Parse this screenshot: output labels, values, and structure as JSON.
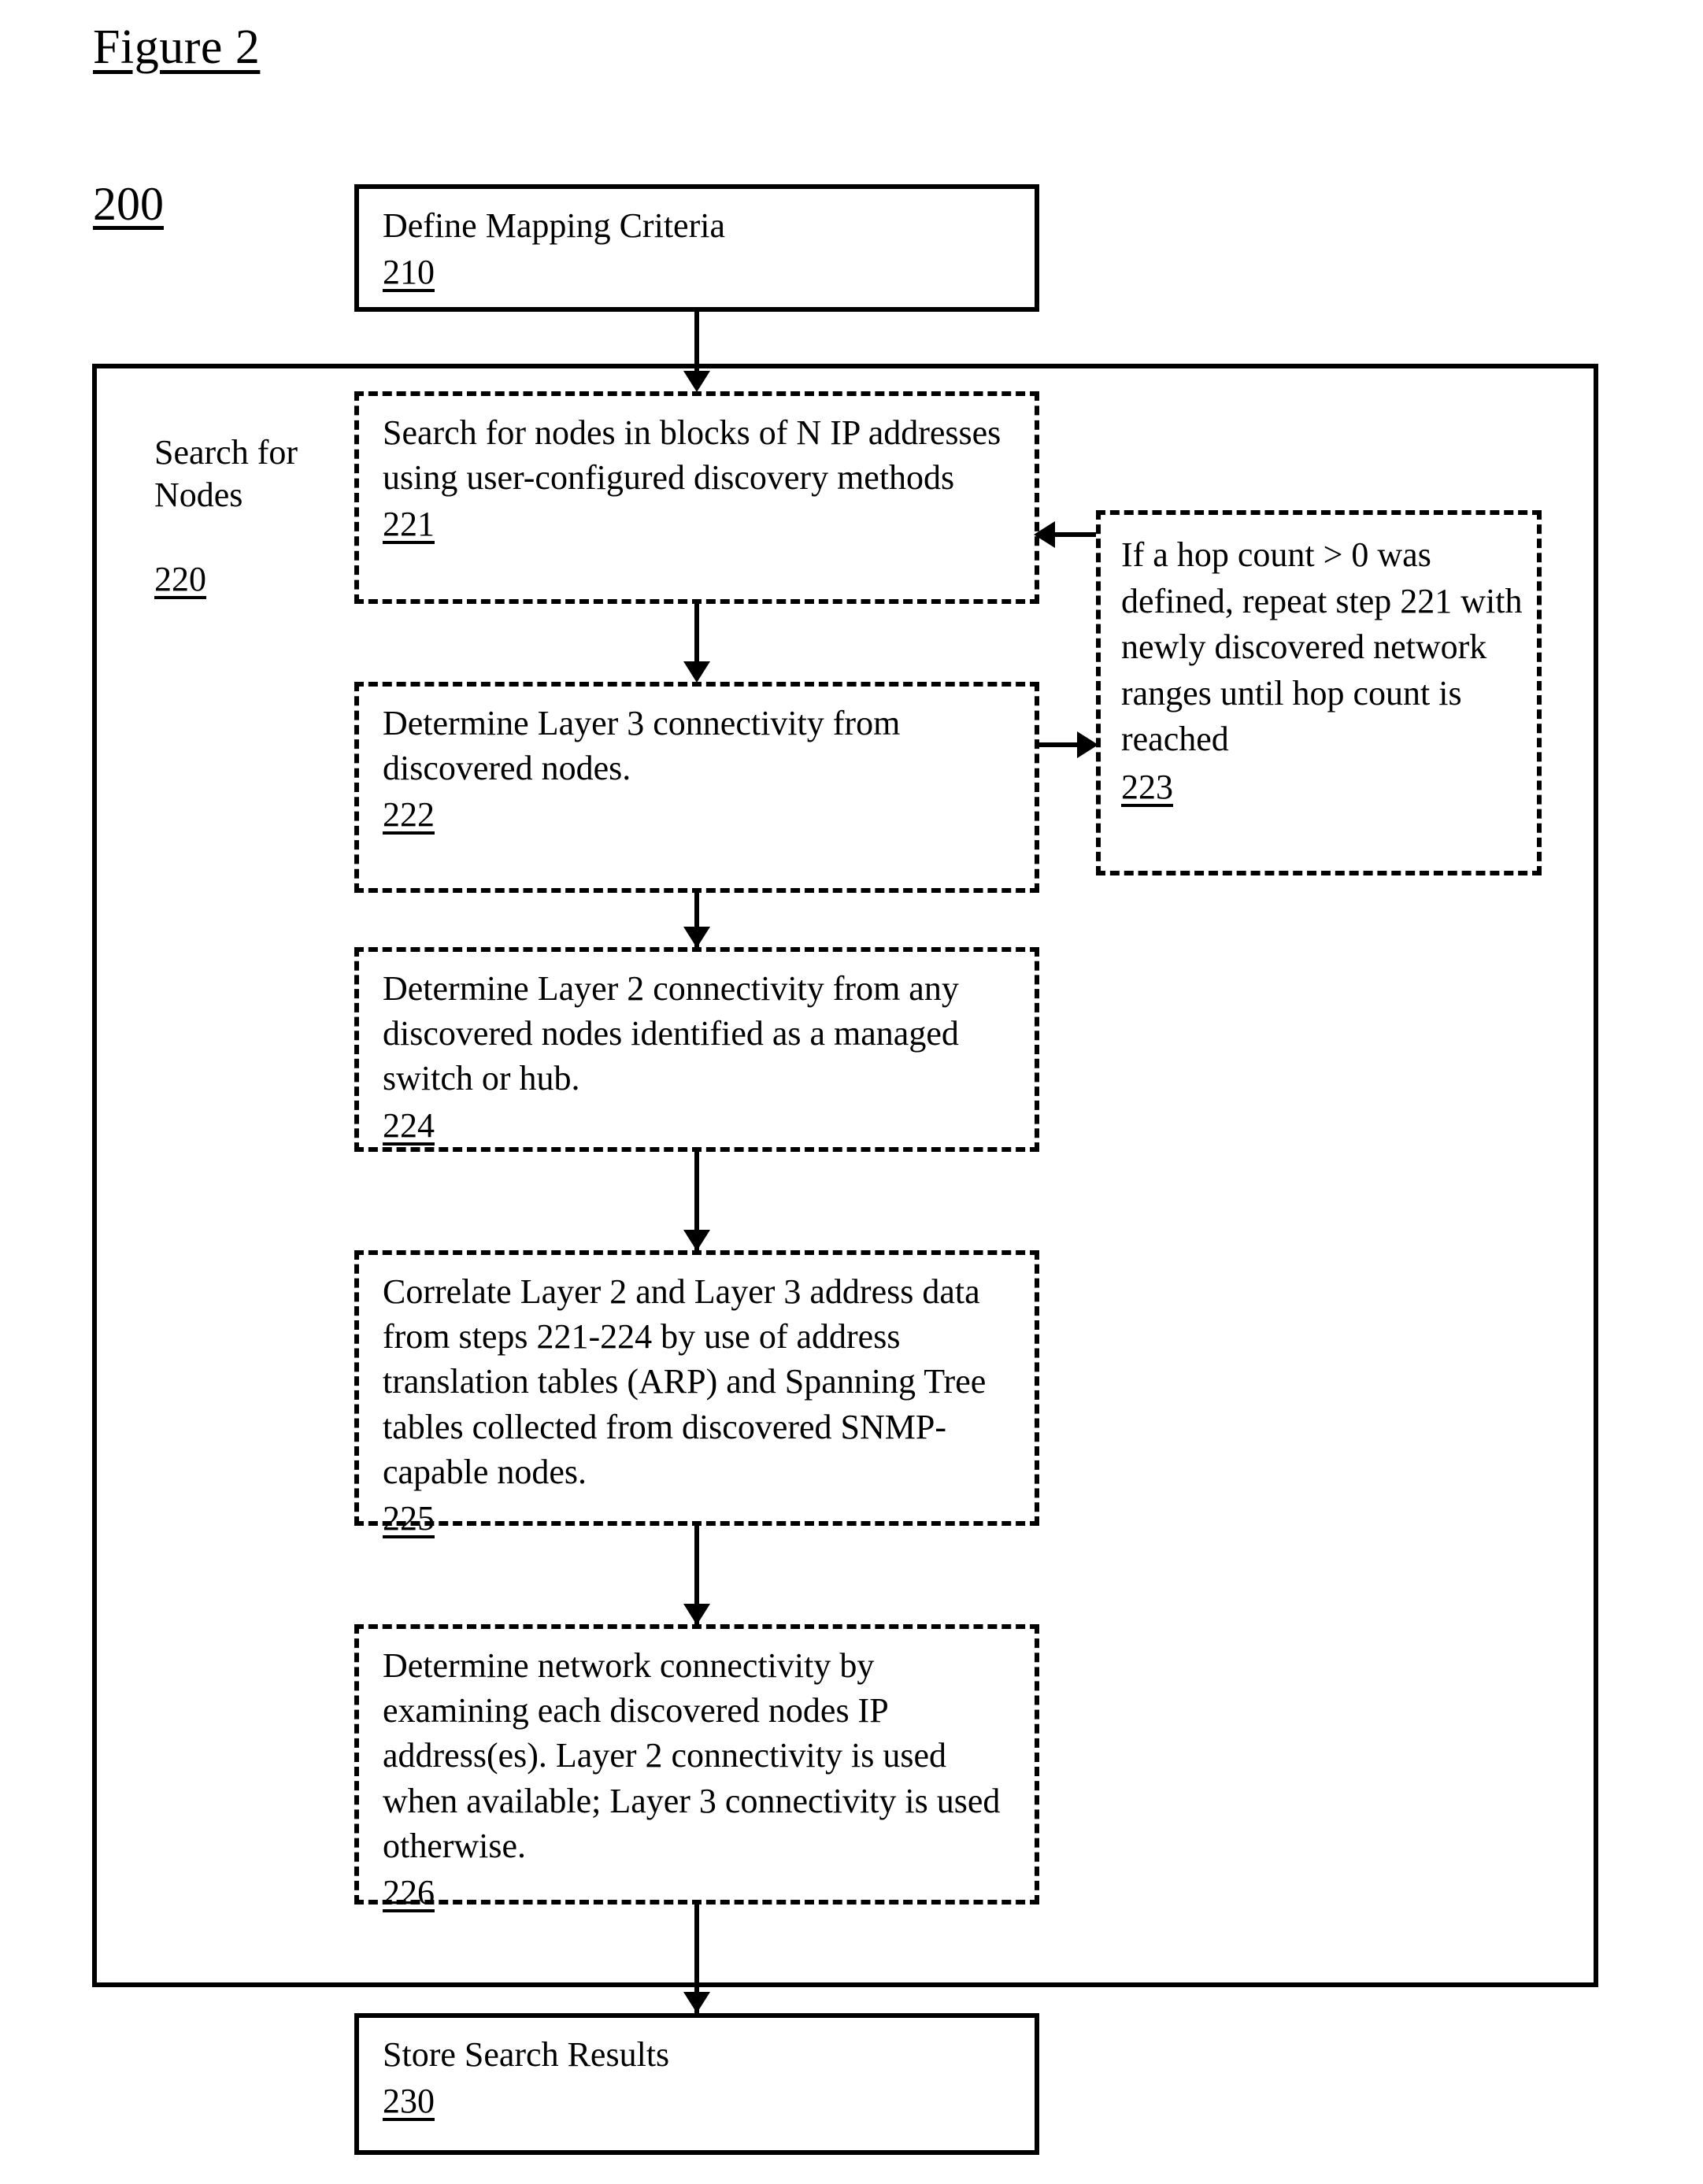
{
  "figure": {
    "title": "Figure 2",
    "diagram_number": "200"
  },
  "group": {
    "label": "Search for Nodes",
    "number": "220"
  },
  "boxes": {
    "b210": {
      "text": "Define Mapping Criteria",
      "number": "210",
      "border": "solid"
    },
    "b221": {
      "text": "Search for nodes in blocks of N IP addresses using user-configured discovery methods",
      "number": "221",
      "border": "dashed"
    },
    "b222": {
      "text": "Determine Layer 3 connectivity from discovered nodes.",
      "number": "222",
      "border": "dashed"
    },
    "b223": {
      "text": "If a hop count > 0 was defined, repeat step 221 with newly discovered network ranges until hop count is reached",
      "number": "223",
      "border": "dashed"
    },
    "b224": {
      "text": "Determine Layer 2 connectivity from any discovered nodes identified as a managed switch or hub.",
      "number": "224",
      "border": "dashed"
    },
    "b225": {
      "text": "Correlate Layer 2 and Layer 3 address data from steps 221-224 by use of address translation tables (ARP) and Spanning Tree tables collected from discovered SNMP-capable nodes.",
      "number": "225",
      "border": "dashed"
    },
    "b226": {
      "text": "Determine network connectivity by examining each discovered nodes IP address(es). Layer 2 connectivity is used when available; Layer 3 connectivity is used otherwise.",
      "number": "226",
      "border": "dashed"
    },
    "b230": {
      "text": "Store Search Results",
      "number": "230",
      "border": "solid"
    }
  },
  "flow": {
    "edges": [
      {
        "from": "210",
        "to": "221",
        "direction": "down"
      },
      {
        "from": "221",
        "to": "222",
        "direction": "down"
      },
      {
        "from": "222",
        "to": "223",
        "direction": "right"
      },
      {
        "from": "223",
        "to": "221",
        "direction": "left"
      },
      {
        "from": "222",
        "to": "224",
        "direction": "down"
      },
      {
        "from": "224",
        "to": "225",
        "direction": "down"
      },
      {
        "from": "225",
        "to": "226",
        "direction": "down"
      },
      {
        "from": "226",
        "to": "230",
        "direction": "down"
      }
    ]
  },
  "colors": {
    "ink": "#000000",
    "paper": "#ffffff"
  }
}
